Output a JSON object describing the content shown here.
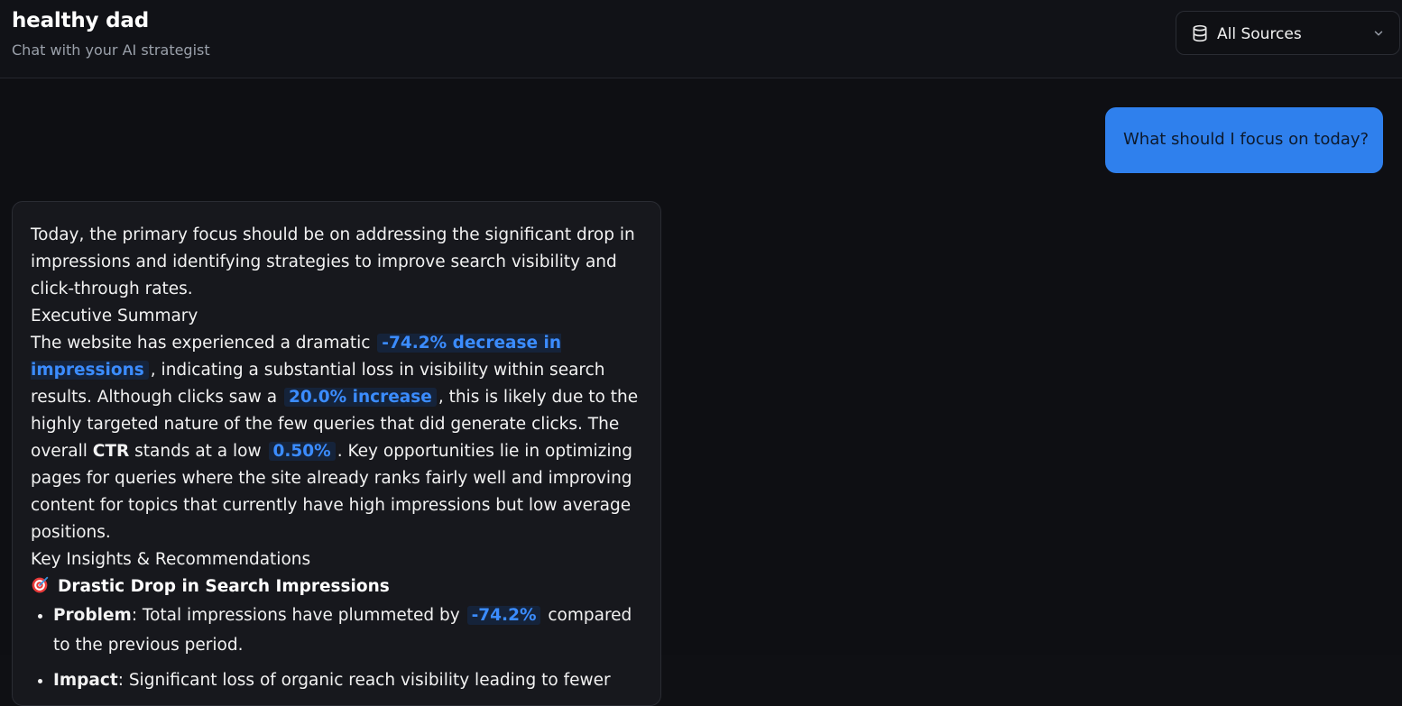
{
  "header": {
    "title": "healthy dad",
    "subtitle": "Chat with your AI strategist",
    "source_select": {
      "icon": "database-icon",
      "selected": "All Sources"
    }
  },
  "colors": {
    "background": "#0f1014",
    "user_bubble": "#2f80ed",
    "highlight_text": "#3b8cff",
    "highlight_bg": "#15233a"
  },
  "messages": {
    "user": {
      "text": "What should I focus on today?"
    },
    "assistant": {
      "intro": "Today, the primary focus should be on addressing the significant drop in impressions and identifying strategies to improve search visibility and click-through rates.",
      "executive_summary_heading": "Executive Summary",
      "summary": {
        "part1": "The website has experienced a dramatic",
        "hl1": "-74.2% decrease in impressions",
        "part2": ", indicating a substantial loss in visibility within search results. Although clicks saw a",
        "hl2": "20.0% increase",
        "part3": ", this is likely due to the highly targeted nature of the few queries that did generate clicks. The overall",
        "bold_ctr": "CTR",
        "part4": "stands at a low",
        "hl3": "0.50%",
        "part5": ". Key opportunities lie in optimizing pages for queries where the site already ranks fairly well and improving content for topics that currently have high impressions but low average positions."
      },
      "insights_heading": "Key Insights & Recommendations",
      "insight_1": {
        "icon": "target-icon",
        "title": "Drastic Drop in Search Impressions",
        "problem_label": "Problem",
        "problem_text_a": ": Total impressions have plummeted by",
        "problem_hl": "-74.2%",
        "problem_text_b": "compared to the previous period.",
        "impact_label": "Impact",
        "impact_text": ": Significant loss of organic reach visibility leading to fewer"
      }
    }
  }
}
